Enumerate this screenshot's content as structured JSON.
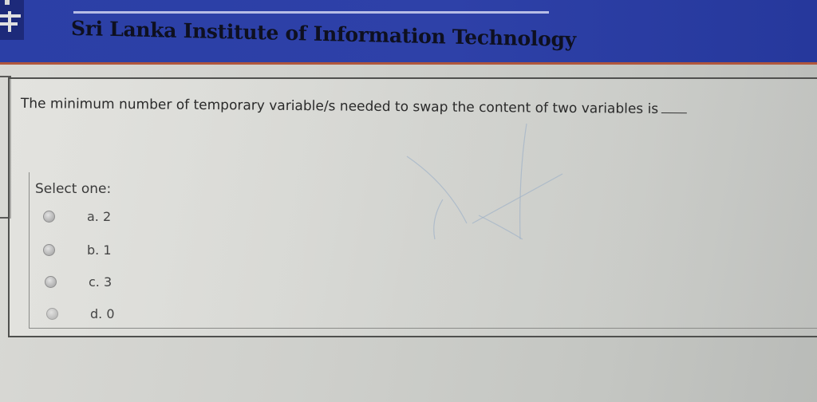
{
  "header": {
    "title": "Sri Lanka Institute of Information Technology",
    "colors": {
      "banner": "#2b3fa6",
      "accent_line": "#b0573d"
    }
  },
  "question": {
    "text": "The minimum number of temporary variable/s needed to swap the content of two variables is",
    "select_label": "Select one:",
    "options": [
      {
        "label": "a. 2",
        "icon": "radio-button-icon"
      },
      {
        "label": "b. 1",
        "icon": "radio-button-icon"
      },
      {
        "label": "c. 3",
        "icon": "radio-button-icon"
      },
      {
        "label": "d. 0",
        "icon": "radio-button-icon"
      }
    ]
  }
}
